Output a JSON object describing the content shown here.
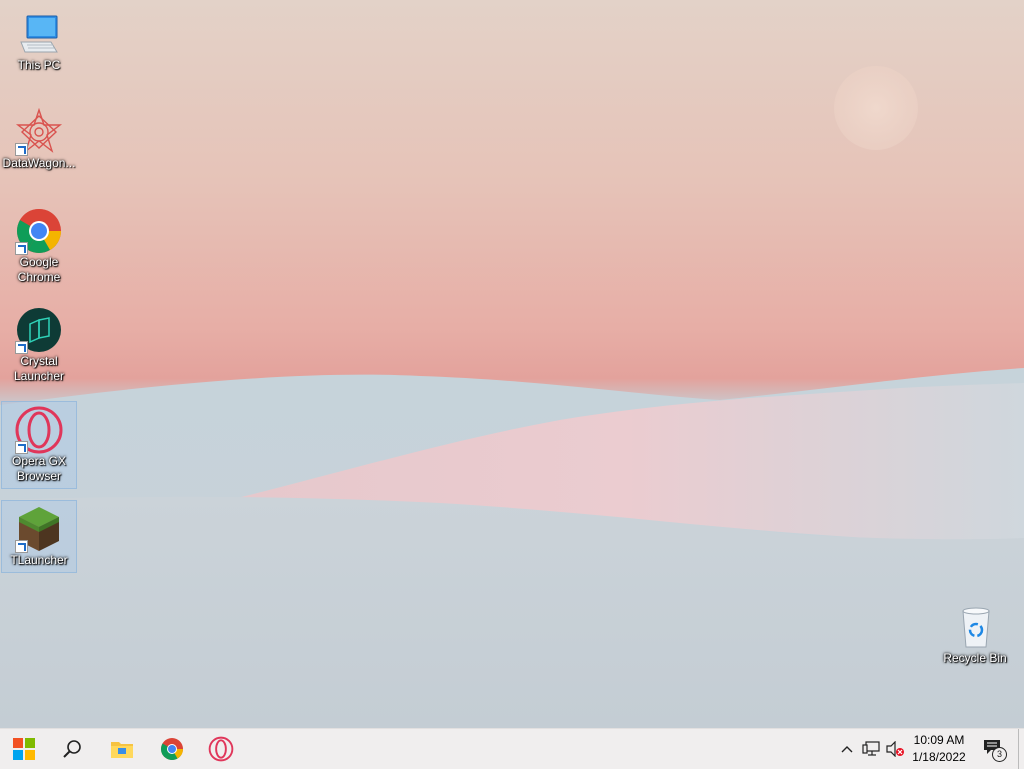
{
  "desktop": {
    "icons": [
      {
        "label": "This PC",
        "icon": "computer-icon"
      },
      {
        "label": "DataWagon...",
        "icon": "datawagon-icon"
      },
      {
        "label": "Google Chrome",
        "icon": "chrome-icon"
      },
      {
        "label": "Crystal Launcher",
        "icon": "crystal-launcher-icon"
      },
      {
        "label": "Opera GX Browser",
        "icon": "opera-gx-icon"
      },
      {
        "label": "TLauncher",
        "icon": "tlauncher-icon"
      },
      {
        "label": "Recycle Bin",
        "icon": "recycle-bin-icon"
      }
    ]
  },
  "taskbar": {
    "pinned": [
      {
        "name": "start-button",
        "icon": "windows-logo-icon"
      },
      {
        "name": "search-button",
        "icon": "search-icon"
      },
      {
        "name": "file-explorer-button",
        "icon": "folder-icon"
      },
      {
        "name": "chrome-taskbar-button",
        "icon": "chrome-icon"
      },
      {
        "name": "opera-taskbar-button",
        "icon": "opera-gx-icon"
      }
    ],
    "tray": {
      "icons": [
        "chevron-up-icon",
        "network-icon",
        "volume-muted-icon"
      ],
      "time": "10:09 AM",
      "date": "1/18/2022",
      "notification_count": "3"
    }
  },
  "colors": {
    "accent": "#1e6cc8",
    "taskbar_bg": "#f0eeee"
  }
}
